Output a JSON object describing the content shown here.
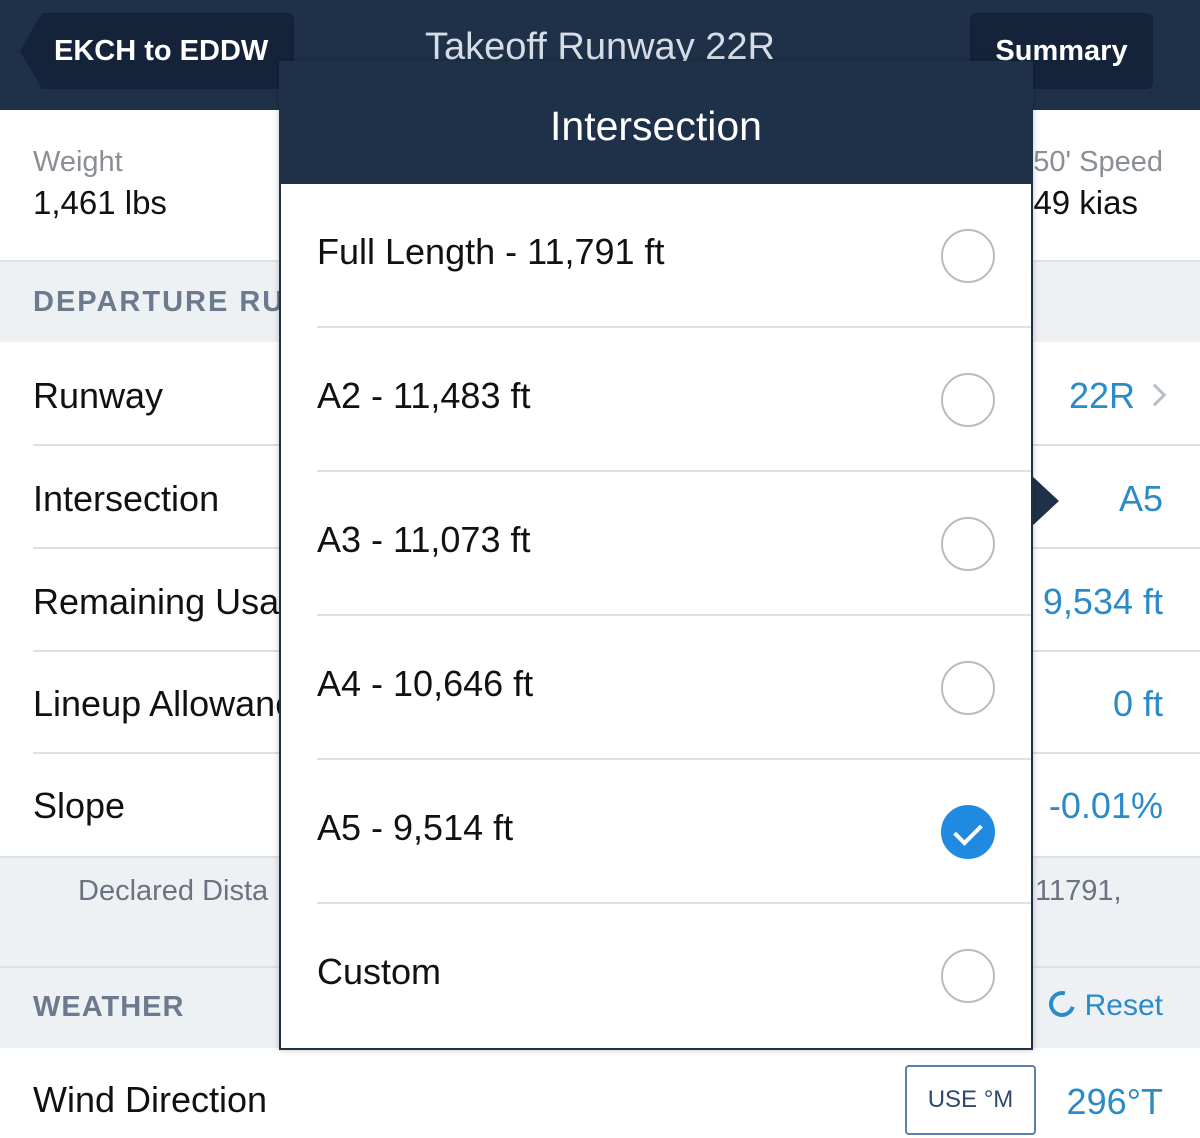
{
  "nav": {
    "back_label": "EKCH to EDDW",
    "title": "Takeoff Runway 22R",
    "summary_label": "Summary"
  },
  "top_stats": {
    "weight_label": "Weight",
    "weight_value": "1,461 lbs",
    "speed_label": "50' Speed",
    "speed_value": "49 kias"
  },
  "departure": {
    "section_label": "DEPARTURE RUNWAY",
    "rows": [
      {
        "label": "Runway",
        "value": "22R"
      },
      {
        "label": "Intersection",
        "value": "A5"
      },
      {
        "label": "Remaining Usable",
        "value": "9,534 ft"
      },
      {
        "label": "Lineup Allowance",
        "value": "0 ft"
      },
      {
        "label": "Slope",
        "value": "-0.01%"
      }
    ],
    "declared_label": "Declared Dista",
    "declared_value": "11791,"
  },
  "weather": {
    "section_label": "WEATHER",
    "reset_label": "Reset",
    "wind_label": "Wind Direction",
    "use_mag_label": "USE °M",
    "wind_value": "296°T"
  },
  "popover": {
    "title": "Intersection",
    "options": [
      {
        "label": "Full Length - 11,791 ft",
        "checked": false
      },
      {
        "label": "A2 - 11,483 ft",
        "checked": false
      },
      {
        "label": "A3 - 11,073 ft",
        "checked": false
      },
      {
        "label": "A4 - 10,646 ft",
        "checked": false
      },
      {
        "label": "A5 - 9,514 ft",
        "checked": true
      },
      {
        "label": "Custom",
        "checked": false
      }
    ]
  },
  "colors": {
    "nav_bg": "#1e3148",
    "accent": "#2a8bc7",
    "checked": "#1f8ae0"
  }
}
